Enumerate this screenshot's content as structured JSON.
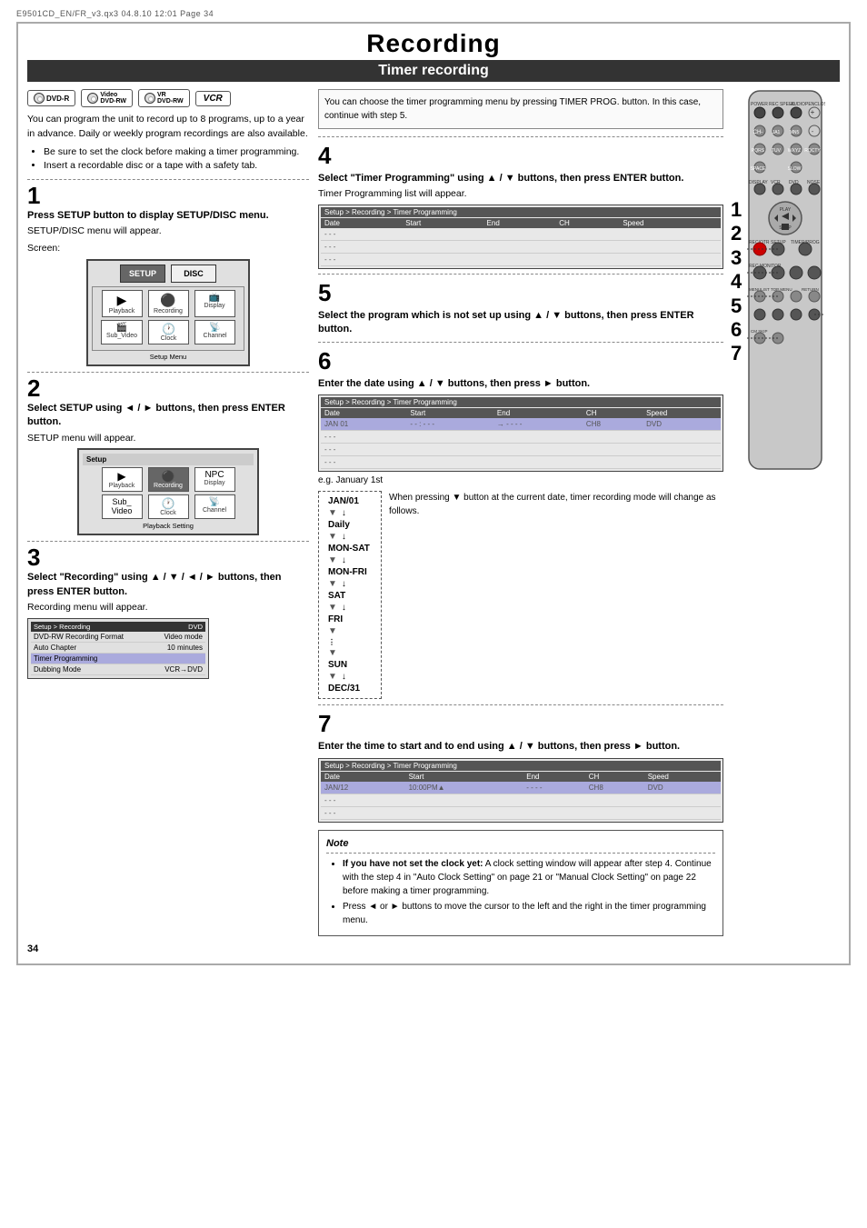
{
  "meta": {
    "line": "E9501CD_EN/FR_v3.qx3   04.8.10   12:01   Page 34"
  },
  "page": {
    "main_title": "Recording",
    "section_title": "Timer recording"
  },
  "devices": {
    "logos": [
      "DVD-R",
      "Video DVD-RW",
      "VR DVD-RW",
      "VCR"
    ]
  },
  "intro": {
    "paragraph": "You can program the unit to record up to 8 programs, up to a year in advance. Daily or weekly program recordings are also available.",
    "bullets": [
      "Be sure to set the clock before making a timer programming.",
      "Insert a recordable disc or a tape with a safety tab."
    ]
  },
  "step1": {
    "number": "1",
    "title": "Press SETUP button to display SETUP/DISC menu.",
    "body": "SETUP/DISC menu will appear.",
    "screen_label": "Screen:",
    "screen_menu_label": "Setup Menu",
    "setup_items": {
      "top": [
        "SETUP",
        "DISC"
      ],
      "row1": [
        "Playback",
        "Recording",
        "Display"
      ],
      "row2": [
        "Sub_Video",
        "Clock",
        "Channel"
      ]
    }
  },
  "step2": {
    "number": "2",
    "title": "Select SETUP using ◄ / ► buttons, then press ENTER button.",
    "body": "SETUP menu will appear.",
    "setup_rows": [
      {
        "label": "Setup"
      },
      {
        "items": [
          "Playback",
          "Recording",
          "Display"
        ]
      },
      {
        "items": [
          "Sub_Video",
          "Clock",
          "Channel"
        ]
      }
    ],
    "sublabel": "Playback Setting"
  },
  "step3": {
    "number": "3",
    "title": "Select \"Recording\" using ▲ / ▼ / ◄ / ► buttons, then press ENTER button.",
    "body": "Recording menu will appear.",
    "menu_header": "Setup > Recording",
    "menu_badge": "DVD",
    "menu_rows": [
      {
        "label": "DVD-RW Recording Format",
        "value": "Video mode"
      },
      {
        "label": "Auto Chapter",
        "value": "10 minutes"
      },
      {
        "label": "Timer Programming",
        "value": ""
      },
      {
        "label": "Dubbing Mode",
        "value": "VCR→DVD"
      }
    ]
  },
  "step4": {
    "number": "4",
    "title": "Select \"Timer Programming\" using ▲ / ▼ buttons, then press ENTER button.",
    "body": "Timer Programming list will appear.",
    "table_header": "Setup > Recording > Timer Programming",
    "columns": [
      "Date",
      "Start",
      "End",
      "CH",
      "Speed"
    ],
    "rows": [
      "- - -",
      "- - -",
      "- - -"
    ]
  },
  "right_note": {
    "text": "You can choose the timer programming menu by pressing TIMER PROG. button. In this case, continue with step 5."
  },
  "step5": {
    "number": "5",
    "title": "Select the program which is not set up using ▲ / ▼ buttons, then press ENTER button."
  },
  "step6": {
    "number": "6",
    "title": "Enter the date using ▲ / ▼ buttons, then press ► button.",
    "table_header": "Setup > Recording > Timer Programming",
    "columns": [
      "Date",
      "Start",
      "End",
      "CH",
      "Speed"
    ],
    "example_row": [
      "JAN 01",
      "- - : - - -",
      "→ - - - -",
      "CH8",
      "DVD"
    ],
    "rows": [
      "- - -",
      "- - -",
      "- - -"
    ],
    "eg": "e.g. January 1st",
    "date_sequence": [
      "JAN/01",
      "Daily",
      "MON-SAT",
      "MON-FRI",
      "SAT",
      "FRI",
      "SUN",
      "DEC/31"
    ],
    "date_note": "When pressing ▼ button at the current date, timer recording mode will change as follows."
  },
  "step7": {
    "number": "7",
    "title": "Enter the time to start and to end using ▲ / ▼ buttons, then press ► button.",
    "table_header": "Setup > Recording > Timer Programming",
    "columns": [
      "Date",
      "Start",
      "End",
      "CH",
      "Speed"
    ],
    "example_row": [
      "JAN/12",
      "10:00PM▲",
      "- - - -",
      "CH8",
      "DVD"
    ],
    "rows": [
      "- - -",
      "- - -"
    ]
  },
  "note_box": {
    "title": "Note",
    "bullets": [
      {
        "subtitle": "If you have not set the clock yet:",
        "text": "A clock setting window will appear after step 4.  Continue with the step 4 in \"Auto Clock Setting\" on page 21 or \"Manual Clock Setting\" on page 22 before making a timer programming."
      },
      {
        "text": "Press ◄ or ► buttons to move the cursor to the left and the right in the timer programming menu."
      }
    ]
  },
  "side_step_numbers": [
    "1",
    "2",
    "3",
    "4",
    "5",
    "6",
    "7"
  ],
  "page_number": "34"
}
